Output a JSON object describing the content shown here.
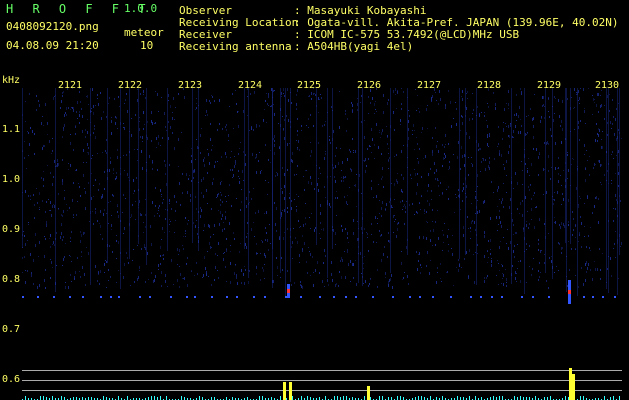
{
  "header": {
    "app_name": "H R O F F T",
    "version": "1.0.0",
    "filename": "0408092120.png",
    "timestamp": "04.08.09 21:20",
    "meteor_label": "meteor",
    "meteor_count": "10",
    "observer_label": "Observer",
    "observer_value": ": Masayuki Kobayashi",
    "location_label": "Receiving Location",
    "location_value": ": Ogata-vill. Akita-Pref. JAPAN (139.96E, 40.02N)",
    "receiver_label": "Receiver",
    "receiver_value": ": ICOM IC-575 53.7492(@LCD)MHz USB",
    "antenna_label": "Receiving antenna",
    "antenna_value": ": A504HB(yagi 4el)"
  },
  "axis": {
    "unit": "kHz",
    "time_ticks": [
      "2121",
      "2122",
      "2123",
      "2124",
      "2125",
      "2126",
      "2127",
      "2128",
      "2129",
      "2130"
    ],
    "freq_ticks": [
      "1.1",
      "1.0",
      "0.9",
      "0.8",
      "0.7",
      "0.6"
    ]
  },
  "colors": {
    "background": "#000000",
    "noise": "#1a2a8a",
    "meteor_line": "#3355ff",
    "echo_hot": "#ff3333",
    "bar_color": "#ffff33",
    "bar_low": "#33ffff"
  }
}
